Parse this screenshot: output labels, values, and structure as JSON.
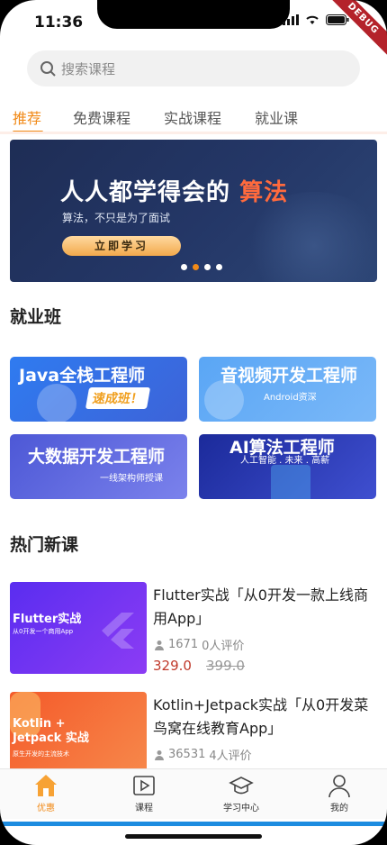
{
  "status_bar": {
    "time": "11:36",
    "debug_label": "DEBUG"
  },
  "search": {
    "placeholder": "搜索课程"
  },
  "tabs": [
    {
      "label": "推荐",
      "active": true
    },
    {
      "label": "免费课程"
    },
    {
      "label": "实战课程"
    },
    {
      "label": "就业课"
    }
  ],
  "banner": {
    "title": "人人都学得会的",
    "title_accent": "算法",
    "subtitle": "算法，不只是为了面试",
    "button": "立即学习",
    "dots": 4,
    "active_dot": 1
  },
  "jobs_section": {
    "title": "就业班",
    "cards": [
      {
        "title": "Java全栈工程师",
        "sub": "速成班！"
      },
      {
        "title": "音视频开发工程师",
        "sub": "Android资深"
      },
      {
        "title": "大数据开发工程师",
        "sub": "一线架构师授课"
      },
      {
        "title": "AI算法工程师",
        "sub": "人工智能 . 未来 . 高薪"
      }
    ]
  },
  "hot_section": {
    "title": "热门新课",
    "courses": [
      {
        "thumb_title": "Flutter实战",
        "thumb_sub": "从0开发一个商用App",
        "name": "Flutter实战「从0开发一款上线商用App」",
        "learners": "1671",
        "reviews": "0人评价",
        "price": "329.0",
        "original_price": "399.0"
      },
      {
        "thumb_title": "Kotlin + Jetpack 实战",
        "thumb_sub": "原生开发的主流技术",
        "name": "Kotlin+Jetpack实战「从0开发菜鸟窝在线教育App」",
        "learners": "36531",
        "reviews": "4人评价"
      }
    ]
  },
  "bottom_nav": [
    {
      "label": "优惠",
      "icon": "home-icon",
      "active": true
    },
    {
      "label": "课程",
      "icon": "video-icon"
    },
    {
      "label": "学习中心",
      "icon": "graduation-cap-icon"
    },
    {
      "label": "我的",
      "icon": "user-icon"
    }
  ],
  "colors": {
    "accent": "#f18a18",
    "price": "#c0392b",
    "nav_bar_line": "#1d8ce0"
  }
}
